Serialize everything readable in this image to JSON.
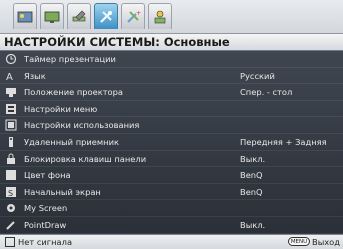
{
  "tabs": [
    {
      "icon": "picture-icon",
      "active": false
    },
    {
      "icon": "display-icon",
      "active": false
    },
    {
      "icon": "settings-wrench-icon",
      "active": false
    },
    {
      "icon": "system-settings-icon",
      "active": true
    },
    {
      "icon": "advanced-settings-icon",
      "active": false
    },
    {
      "icon": "info-icon",
      "active": false
    }
  ],
  "title": "НАСТРОЙКИ СИСТЕМЫ: Основные",
  "items": [
    {
      "label": "Таймер презентации",
      "value": "",
      "icon": "timer-icon"
    },
    {
      "label": "Язык",
      "value": "Русский",
      "icon": "language-icon"
    },
    {
      "label": "Положение проектора",
      "value": "Спер. - стол",
      "icon": "projector-position-icon"
    },
    {
      "label": "Настройки меню",
      "value": "",
      "icon": "menu-settings-icon"
    },
    {
      "label": "Настройки использования",
      "value": "",
      "icon": "usage-settings-icon"
    },
    {
      "label": "Удаленный приемник",
      "value": "Передняя + Задняя",
      "icon": "remote-receiver-icon"
    },
    {
      "label": "Блокировка клавиш панели",
      "value": "Выкл.",
      "icon": "panel-lock-icon"
    },
    {
      "label": "Цвет фона",
      "value": "BenQ",
      "icon": "background-color-icon"
    },
    {
      "label": "Начальный экран",
      "value": "BenQ",
      "icon": "splash-screen-icon"
    },
    {
      "label": "My Screen",
      "value": "",
      "icon": "my-screen-icon"
    },
    {
      "label": "PointDraw",
      "value": "Выкл.",
      "icon": "pointdraw-icon"
    }
  ],
  "footer": {
    "status": "Нет сигнала",
    "menu_key": "MENU",
    "exit_label": "Выход"
  }
}
